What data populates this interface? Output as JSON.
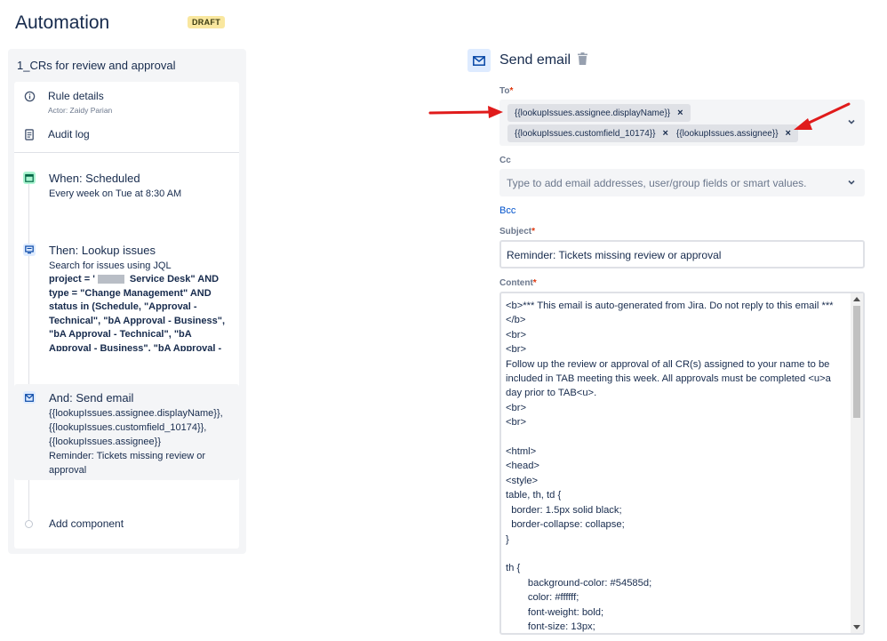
{
  "page": {
    "title": "Automation",
    "badge": "DRAFT"
  },
  "rule": {
    "name": "1_CRs for review and approval",
    "details_label": "Rule details",
    "actor": "Actor: Zaidy Parian",
    "audit_label": "Audit log"
  },
  "steps": {
    "trigger": {
      "title": "When: Scheduled",
      "subtitle": "Every week on Tue at 8:30 AM"
    },
    "lookup": {
      "title": "Then: Lookup issues",
      "subtitle": "Search for issues using JQL",
      "jql_lines": [
        "project = '",
        " Service Desk\" AND",
        "type = \"Change Management\" AND",
        "status in (Schedule, \"Approval -",
        "Technical\", \"bA Approval - Business\",",
        "\"bA Approval - Technical\", \"bA",
        "Approval - Business\", \"bA Approval -"
      ]
    },
    "email": {
      "title": "And: Send email",
      "lines": [
        "{{lookupIssues.assignee.displayName}},",
        "{{lookupIssues.customfield_10174}},",
        "{{lookupIssues.assignee}}",
        "Reminder: Tickets missing review or",
        "approval"
      ]
    },
    "add_component": "Add component"
  },
  "editor": {
    "title": "Send email",
    "to_label": "To",
    "to_chips": [
      "{{lookupIssues.assignee.displayName}}",
      "{{lookupIssues.customfield_10174}}",
      "{{lookupIssues.assignee}}"
    ],
    "chip_remove": "×",
    "cc_label": "Cc",
    "cc_placeholder": "Type to add email addresses, user/group fields or smart values.",
    "bcc_label": "Bcc",
    "subject_label": "Subject",
    "subject_value": "Reminder: Tickets missing review or approval",
    "content_label": "Content",
    "content_value": "<b>*** This email is auto-generated from Jira. Do not reply to this email ***\n</b>\n<br>\n<br>\nFollow up the review or approval of all CR(s) assigned to your name to be\nincluded in TAB meeting this week. All approvals must be completed <u>a\nday prior to TAB<u>.\n<br>\n<br>\n\n<html>\n<head>\n<style>\ntable, th, td {\n  border: 1.5px solid black;\n  border-collapse: collapse;\n}\n\nth {\n        background-color: #54585d;\n        color: #ffffff;\n        font-weight: bold;\n        font-size: 13px;"
  },
  "colors": {
    "accent_red": "#de350b",
    "link_blue": "#0052cc",
    "trigger_icon_bg": "#abf5d1",
    "action_icon_bg": "#deebff",
    "annotation_arrow": "#e01b1b"
  },
  "icons": {
    "details": "info-icon",
    "audit": "document-icon",
    "trigger": "calendar-icon",
    "lookup": "monitor-icon",
    "email": "mail-icon",
    "delete": "trash-icon",
    "dropdown": "chevron-down-icon"
  }
}
